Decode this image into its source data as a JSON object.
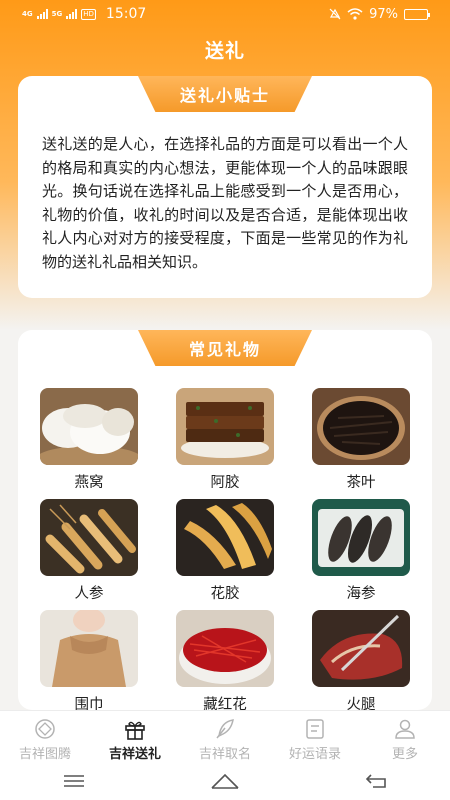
{
  "status_bar": {
    "net1": "4G",
    "net2": "5G",
    "hd": "HD",
    "time": "15:07",
    "battery": "97%",
    "battery_level": 0.97
  },
  "header": {
    "title": "送礼"
  },
  "tips_card": {
    "title": "送礼小贴士",
    "body": "送礼送的是人心，在选择礼品的方面是可以看出一个人的格局和真实的内心想法，更能体现一个人的品味跟眼光。换句话说在选择礼品上能感受到一个人是否用心，礼物的价值，收礼的时间以及是否合适，是能体现出收礼人内心对对方的接受程度，下面是一些常见的作为礼物的送礼礼品相关知识。"
  },
  "gifts_card": {
    "title": "常见礼物",
    "items": [
      {
        "label": "燕窝",
        "icon": "birds-nest-image"
      },
      {
        "label": "阿胶",
        "icon": "ejiao-image"
      },
      {
        "label": "茶叶",
        "icon": "tea-leaves-image"
      },
      {
        "label": "人参",
        "icon": "ginseng-image"
      },
      {
        "label": "花胶",
        "icon": "fish-maw-image"
      },
      {
        "label": "海参",
        "icon": "sea-cucumber-image"
      },
      {
        "label": "围巾",
        "icon": "scarf-image"
      },
      {
        "label": "藏红花",
        "icon": "saffron-image"
      },
      {
        "label": "火腿",
        "icon": "ham-image"
      }
    ]
  },
  "bottom_nav": {
    "active_index": 1,
    "items": [
      {
        "label": "吉祥图腾",
        "icon": "totem-icon"
      },
      {
        "label": "吉祥送礼",
        "icon": "gift-icon"
      },
      {
        "label": "吉祥取名",
        "icon": "feather-pen-icon"
      },
      {
        "label": "好运语录",
        "icon": "quote-book-icon"
      },
      {
        "label": "更多",
        "icon": "person-icon"
      }
    ]
  },
  "system_nav": {
    "icons": [
      "menu-icon",
      "home-icon",
      "back-icon"
    ]
  },
  "colors": {
    "accent": "#ff9a17",
    "text": "#222222",
    "inactive": "#b3b3b3"
  }
}
